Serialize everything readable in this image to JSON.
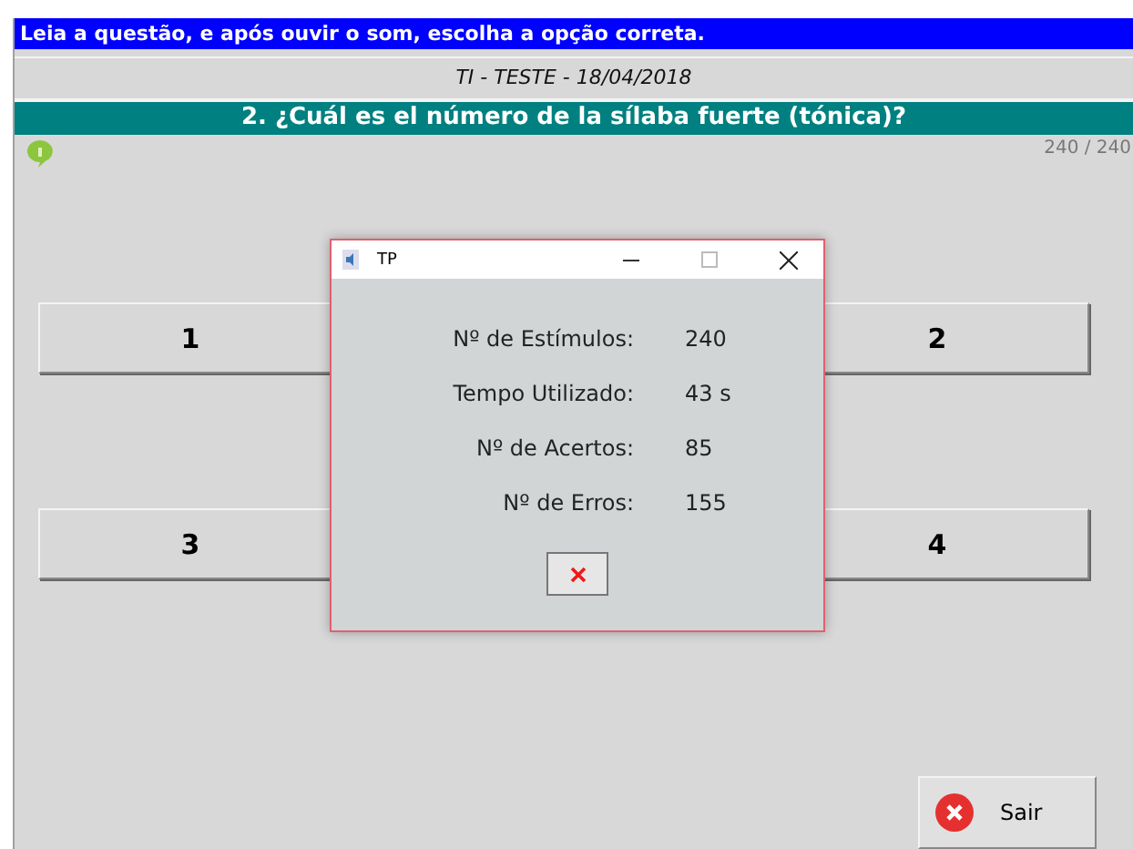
{
  "instruction": "Leia a questão, e após ouvir o som, escolha a opção correta.",
  "test_title": "TI - TESTE - 18/04/2018",
  "question": "2. ¿Cuál es el número de la sílaba fuerte (tónica)?",
  "counter": "240 / 240",
  "options": [
    "1",
    "2",
    "3",
    "4"
  ],
  "exit_button": "Sair",
  "dialog": {
    "title": "TP",
    "stats": [
      {
        "label": "Nº de Estímulos:",
        "value": "240"
      },
      {
        "label": "Tempo Utilizado:",
        "value": "43 s"
      },
      {
        "label": "Nº de Acertos:",
        "value": "85"
      },
      {
        "label": "Nº de Erros:",
        "value": "155"
      }
    ]
  }
}
